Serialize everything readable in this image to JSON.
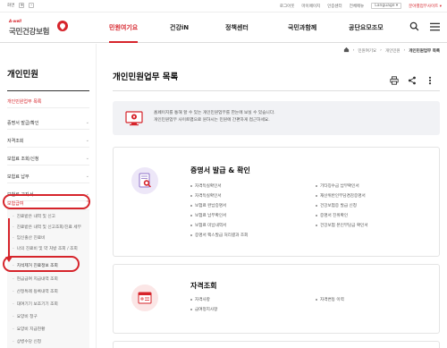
{
  "util_bar": {
    "zoom_label": "화면",
    "zoom_in": "+",
    "zoom_out": "-",
    "links": [
      "로그아웃",
      "마이페이지",
      "인증센터",
      "전체메뉴"
    ],
    "language": "Language",
    "related_sites": "분야별업무사이트"
  },
  "logo": {
    "tagline": "A-well",
    "name": "국민건강보험"
  },
  "gnb": {
    "items": [
      "민원여기요",
      "건강iN",
      "정책센터",
      "국민과함께",
      "공단요모조모"
    ]
  },
  "breadcrumb": {
    "items": [
      "민원여기요",
      "개인민원",
      "개인민원업무 목록"
    ]
  },
  "sidebar": {
    "title": "개인민원",
    "items": [
      {
        "label": "개인민원업무 목록",
        "active": true
      },
      {
        "label": "증명서 발급/확인"
      },
      {
        "label": "자격조회"
      },
      {
        "label": "보험료 조회/신청"
      },
      {
        "label": "보험료 납부"
      },
      {
        "label": "보험료 고지서"
      },
      {
        "label": "보험급여",
        "active": true
      }
    ],
    "sub_items": [
      "진료받은 내역 및 신고",
      "진료받은 내역 및 신고조회/진료 세부",
      "임신출산 진료비",
      "나의 진료비 및 약 처방 조회 / 조회",
      "치석제거 진료정보 조회",
      "현금급여 지급내역 조회",
      "산정특례 등록내역 조회",
      "대여기기 보조기기 조회",
      "요양비 청구",
      "요양비 지급현황",
      "상병수당 신청"
    ]
  },
  "content": {
    "title": "개인민원업무 목록",
    "notice_lines": [
      "홈페이지를 통해 할 수 있는 개인민원업무를 한눈에 보실 수 있습니다.",
      "개인민원업무 사이트맵으로 원하시는 민원에 간편하게 접근하세요."
    ],
    "cards": [
      {
        "title": "증명서 발급 & 확인",
        "links": [
          "자격득실확인서",
          "기타징수금 납부확인서",
          "자격득실확인서",
          "재산위반인부담경감증명서",
          "보험료 완납증명서",
          "건강보험증 발급 신청",
          "보험료 납부확인서",
          "증명서 진위확인",
          "보험료 미납내역서",
          "건강보험 본인부담금 확인서",
          "증명서 팩스발급 처리결과 조회"
        ]
      },
      {
        "title": "자격조회",
        "links": [
          "자격사항",
          "자격변동 이력",
          "급여정지사항"
        ]
      }
    ]
  }
}
